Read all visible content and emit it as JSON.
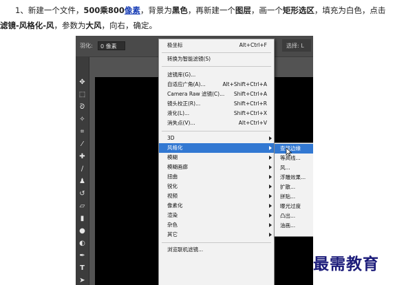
{
  "instructions": {
    "step": "1、新建一个文件，",
    "size_bold": "500乘800",
    "pixel_link": "像素",
    "mid": "，背景为",
    "black": "黑色",
    "mid2": "，再新建一个",
    "layer": "图层",
    "mid3": "，画一个",
    "rect": "矩形选区",
    "mid4": "，填充为白色，点击",
    "filter_path": "滤镜-风格化-风",
    "mid5": "，参数为",
    "big_wind": "大风",
    "end": "，向右，确定。"
  },
  "options_bar": {
    "feather_label": "羽化:",
    "feather_value": "0 像素",
    "right_text": "选择: L"
  },
  "filter_menu": {
    "items": [
      {
        "label": "极坐标",
        "shortcut": "Alt+Ctrl+F"
      },
      {
        "label": "转换为智能滤镜(S)",
        "shortcut": ""
      },
      {
        "label": "滤镜库(G)...",
        "shortcut": ""
      },
      {
        "label": "自适应广角(A)...",
        "shortcut": "Alt+Shift+Ctrl+A"
      },
      {
        "label": "Camera Raw 滤镜(C)...",
        "shortcut": "Shift+Ctrl+A"
      },
      {
        "label": "镜头校正(R)...",
        "shortcut": "Shift+Ctrl+R"
      },
      {
        "label": "液化(L)...",
        "shortcut": "Shift+Ctrl+X"
      },
      {
        "label": "消失点(V)...",
        "shortcut": "Alt+Ctrl+V"
      },
      {
        "label": "3D"
      },
      {
        "label": "风格化"
      },
      {
        "label": "模糊"
      },
      {
        "label": "模糊画廊"
      },
      {
        "label": "扭曲"
      },
      {
        "label": "锐化"
      },
      {
        "label": "视频"
      },
      {
        "label": "像素化"
      },
      {
        "label": "渲染"
      },
      {
        "label": "杂色"
      },
      {
        "label": "其它"
      },
      {
        "label": "浏览联机滤镜..."
      }
    ]
  },
  "stylize_submenu": {
    "items": [
      "查找边缘",
      "等高线...",
      "风...",
      "浮雕效果...",
      "扩散...",
      "拼贴...",
      "曝光过度",
      "凸出...",
      "油画..."
    ]
  },
  "watermark": "最需教育",
  "colors": {
    "highlight": "#3278d2",
    "link": "#1a3fb6",
    "watermark": "#1c1c7a"
  }
}
